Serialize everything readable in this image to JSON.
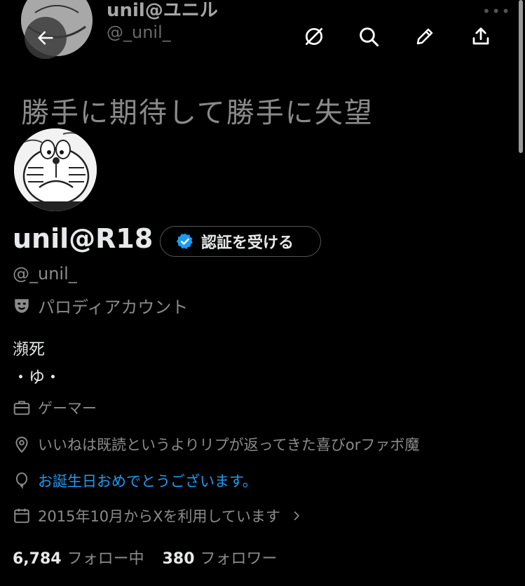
{
  "header": {
    "name": "unil@ユニル",
    "handle": "@_unil_",
    "more": "•••"
  },
  "banner": {
    "text": "勝手に期待して勝手に失望"
  },
  "profile": {
    "display_name": "unil@R18",
    "verify_button_label": "認証を受ける",
    "handle": "@_unil_",
    "parody_label": "パロディアカウント",
    "bio_line1": "瀕死",
    "bio_line2": "・ゆ・",
    "profession": "ゲーマー",
    "location": "いいねは既読というよりリプが返ってきた喜びorファボ魔",
    "birthday": "お誕生日おめでとうございます。",
    "joined": "2015年10月からXを利用しています"
  },
  "stats": {
    "following_count": "6,784",
    "following_label": "フォロー中",
    "followers_count": "380",
    "followers_label": "フォロワー"
  },
  "colors": {
    "background": "#000000",
    "text_primary": "#e7e9ea",
    "text_secondary": "#8b8b8b",
    "accent": "#1d9bf0"
  }
}
